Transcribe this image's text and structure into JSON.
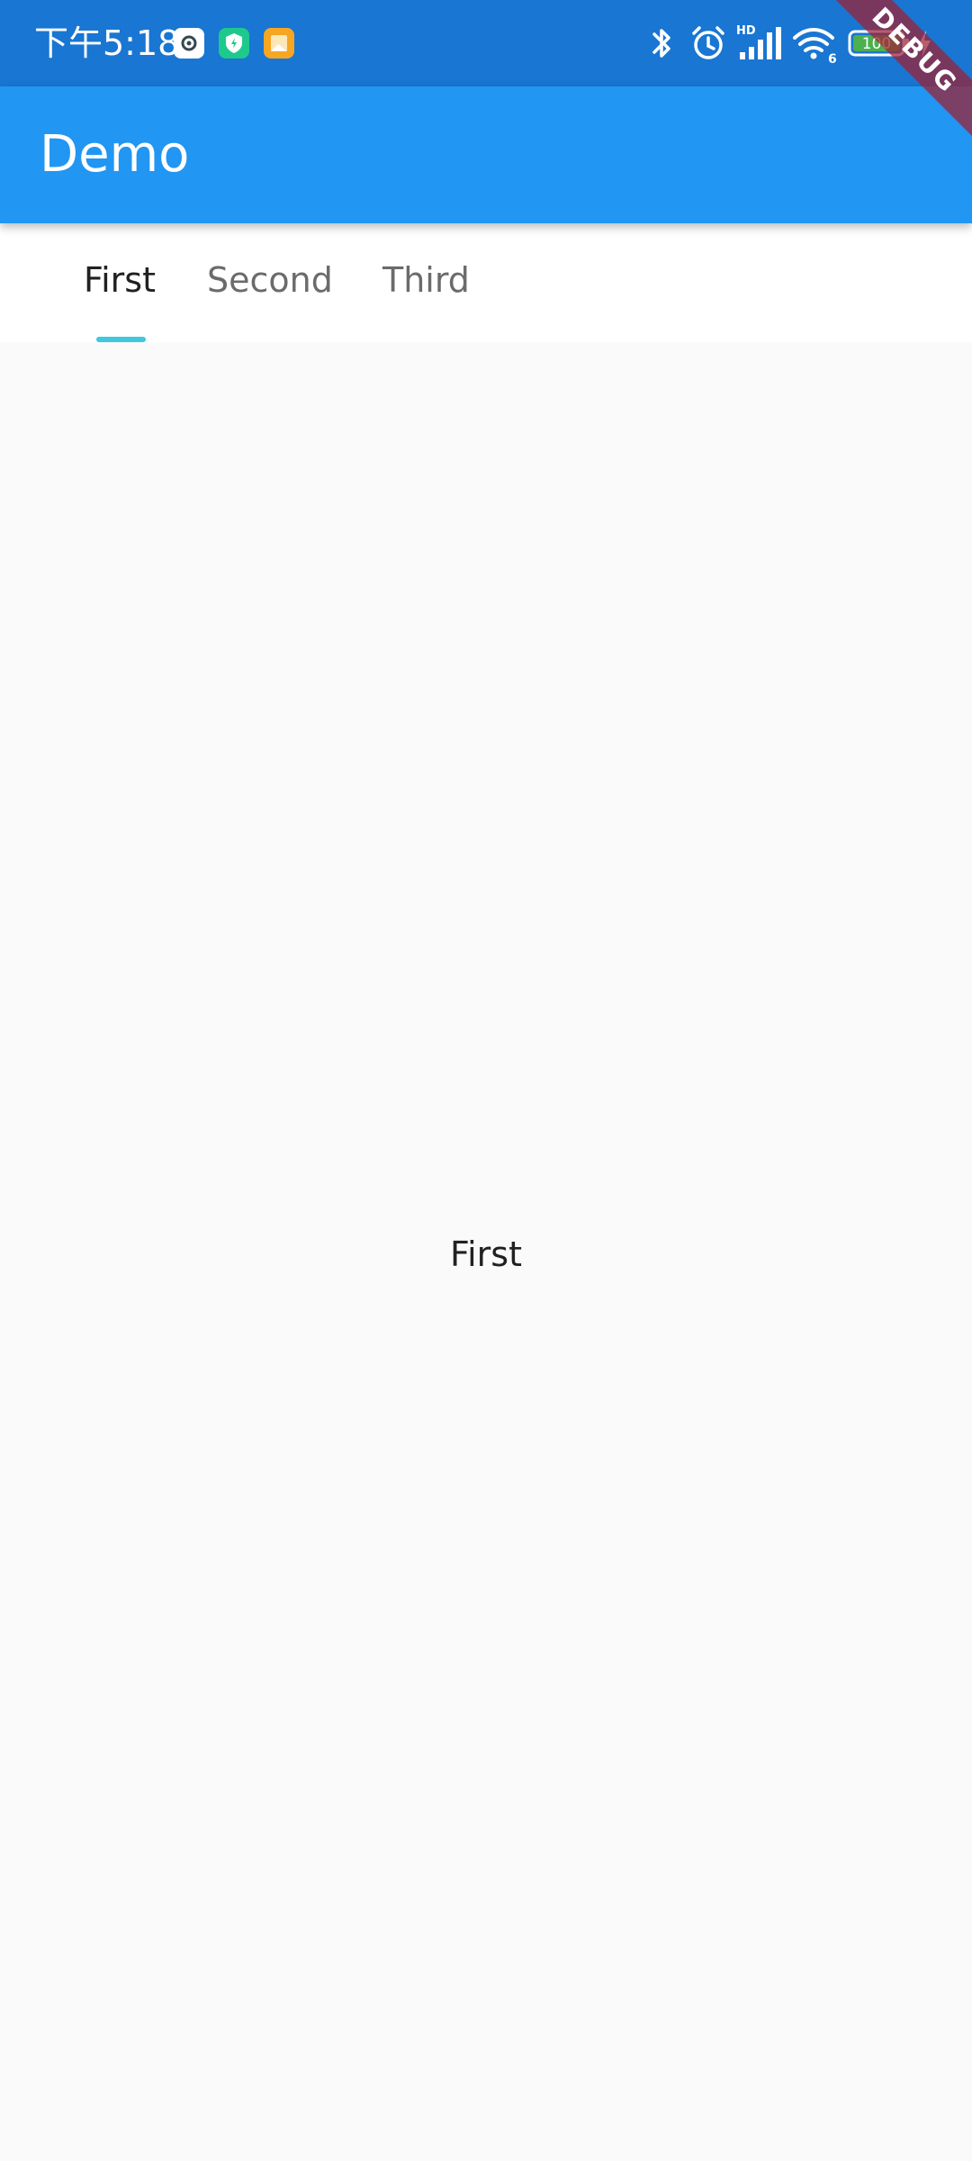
{
  "status_bar": {
    "time": "下午5:18",
    "battery_level": "100",
    "signal_badge": "HD",
    "wifi_badge": "6",
    "colors": {
      "background": "#1976d2"
    }
  },
  "app_bar": {
    "title": "Demo",
    "colors": {
      "background": "#2196f3"
    }
  },
  "tabs": [
    {
      "label": "First",
      "selected": true
    },
    {
      "label": "Second",
      "selected": false
    },
    {
      "label": "Third",
      "selected": false
    }
  ],
  "tab_indicator_color": "#3fc8de",
  "content": {
    "text": "First"
  },
  "debug_banner": {
    "label": "DEBUG"
  },
  "icons": {
    "notifications": [
      "settings-app-icon",
      "security-shield-icon",
      "notes-app-icon"
    ],
    "system": [
      "bluetooth-icon",
      "alarm-icon",
      "cellular-signal-icon",
      "wifi-icon",
      "battery-icon",
      "charging-icon"
    ]
  }
}
